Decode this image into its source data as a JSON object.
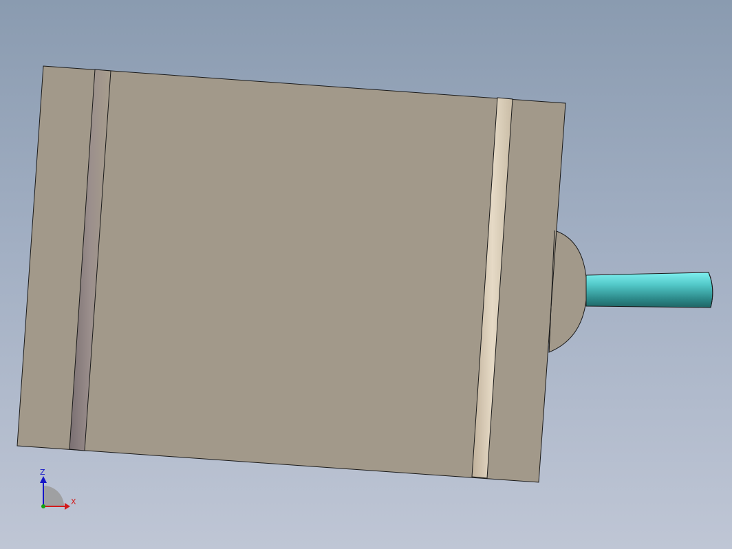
{
  "viewport": {
    "background_top": "#8a9bb0",
    "background_bottom": "#bfc6d5"
  },
  "model": {
    "body_color": "#a2998a",
    "edge_color": "#1a1a1a",
    "shaft_color": "#3fa6a6",
    "groove_dark_color": "#8a7f80",
    "groove_light_color": "#d8cbb6"
  },
  "triad": {
    "z_label": "Z",
    "x_label": "X",
    "z_color": "#1515c8",
    "x_color": "#d21b1b",
    "y_color": "#12a312"
  }
}
